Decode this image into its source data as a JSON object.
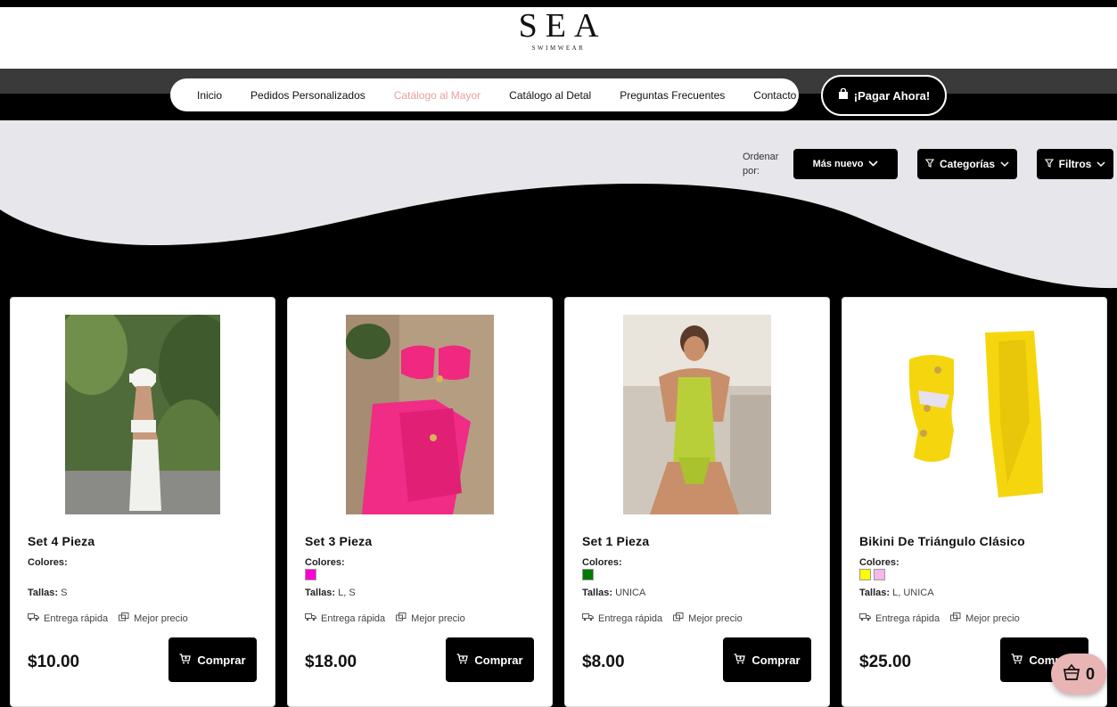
{
  "brand": {
    "name": "SEA",
    "tagline": "SWIMWEAR"
  },
  "nav": {
    "items": [
      {
        "label": "Inicio",
        "active": false
      },
      {
        "label": "Pedidos Personalizados",
        "active": false
      },
      {
        "label": "Catálogo al Mayor",
        "active": true
      },
      {
        "label": "Catálogo al Detal",
        "active": false
      },
      {
        "label": "Preguntas Frecuentes",
        "active": false
      },
      {
        "label": "Contacto",
        "active": false
      }
    ],
    "pay_label": "¡Pagar Ahora!"
  },
  "filters": {
    "sort_label": "Ordenar por:",
    "sort_value": "Más nuevo",
    "categories_label": "Categorías",
    "filters_label": "Filtros"
  },
  "products": [
    {
      "name": "Set 4 Pieza",
      "colors_label": "Colores:",
      "colors": [],
      "sizes_label": "Tallas:",
      "sizes": "S",
      "feat1": "Entrega rápida",
      "feat2": "Mejor precio",
      "price": "$10.00",
      "buy_label": "Comprar"
    },
    {
      "name": "Set 3 Pieza",
      "colors_label": "Colores:",
      "colors": [
        "#ff00d4"
      ],
      "sizes_label": "Tallas:",
      "sizes": "L, S",
      "feat1": "Entrega rápida",
      "feat2": "Mejor precio",
      "price": "$18.00",
      "buy_label": "Comprar"
    },
    {
      "name": "Set 1 Pieza",
      "colors_label": "Colores:",
      "colors": [
        "#007a00"
      ],
      "sizes_label": "Tallas:",
      "sizes": "UNICA",
      "feat1": "Entrega rápida",
      "feat2": "Mejor precio",
      "price": "$8.00",
      "buy_label": "Comprar"
    },
    {
      "name": "Bikini De Triángulo Clásico",
      "colors_label": "Colores:",
      "colors": [
        "#ffff00",
        "#f5b8e8"
      ],
      "sizes_label": "Tallas:",
      "sizes": "L, UNICA",
      "feat1": "Entrega rápida",
      "feat2": "Mejor precio",
      "price": "$25.00",
      "buy_label": "Comprar"
    }
  ],
  "cart": {
    "count": "0"
  }
}
